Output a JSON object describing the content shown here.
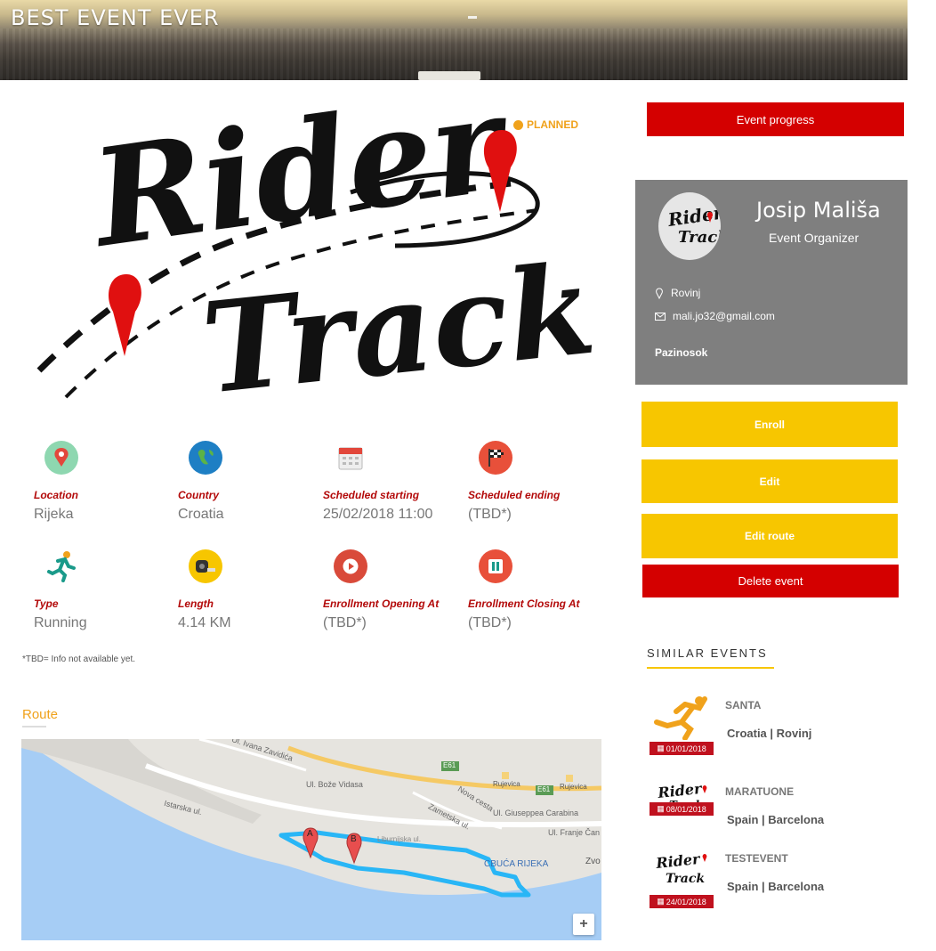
{
  "hero": {
    "title": "BEST EVENT EVER"
  },
  "event": {
    "status": "PLANNED",
    "logo_text": "Rider Track",
    "info": [
      {
        "label": "Location",
        "value": "Rijeka",
        "icon": "map-pin-icon"
      },
      {
        "label": "Country",
        "value": "Croatia",
        "icon": "globe-icon"
      },
      {
        "label": "Scheduled starting",
        "value": "25/02/2018 11:00",
        "icon": "calendar-icon"
      },
      {
        "label": "Scheduled ending",
        "value": "(TBD*)",
        "icon": "finish-flag-icon"
      },
      {
        "label": "Type",
        "value": "Running",
        "icon": "runner-icon"
      },
      {
        "label": "Length",
        "value": "4.14 KM",
        "icon": "measuring-tape-icon"
      },
      {
        "label": "Enrollment Opening At",
        "value": "(TBD*)",
        "icon": "play-icon"
      },
      {
        "label": "Enrollment Closing At",
        "value": "(TBD*)",
        "icon": "pause-icon"
      }
    ],
    "tbd_note": "*TBD= Info not available yet."
  },
  "route": {
    "title": "Route",
    "map_labels": {
      "street1": "Ul. Ivana Zavidića",
      "street2": "Ul. Bože Vidasa",
      "street3": "Istarska ul.",
      "street4": "Nova cesta",
      "street5": "Zametska ul.",
      "street6": "Ul. Giuseppea Carabina",
      "street7": "Ul. Franje Čan",
      "street8": "Liburnijska ul.",
      "e61a": "E61",
      "e61b": "E61",
      "rujevica1": "Rujevica",
      "rujevica2": "Rujevica",
      "poi": "CBUĆA RIJEKA",
      "zvo": "Zvo",
      "marker_a": "A",
      "marker_b": "B"
    },
    "zoom": "+"
  },
  "actions": {
    "event_progress": "Event progress",
    "enroll": "Enroll",
    "edit": "Edit",
    "edit_route": "Edit route",
    "delete_event": "Delete event"
  },
  "organizer": {
    "name": "Josip Mališa",
    "role": "Event Organizer",
    "city": "Rovinj",
    "email": "mali.jo32@gmail.com",
    "team": "Pazinosok"
  },
  "similar": {
    "title": "SIMILAR EVENTS",
    "items": [
      {
        "name": "SANTA",
        "place": "Croatia | Rovinj",
        "date": "01/01/2018",
        "thumb": "runner-icon"
      },
      {
        "name": "MARATUONE",
        "place": "Spain | Barcelona",
        "date": "08/01/2018",
        "thumb": "rider-track-logo"
      },
      {
        "name": "TESTEVENT",
        "place": "Spain | Barcelona",
        "date": "24/01/2018",
        "thumb": "rider-track-logo"
      }
    ]
  },
  "colors": {
    "red": "#d40000",
    "yellow": "#f7c600",
    "orange": "#f0a21b",
    "card_gray": "#7f7f7f",
    "label_red": "#b30a0a"
  }
}
